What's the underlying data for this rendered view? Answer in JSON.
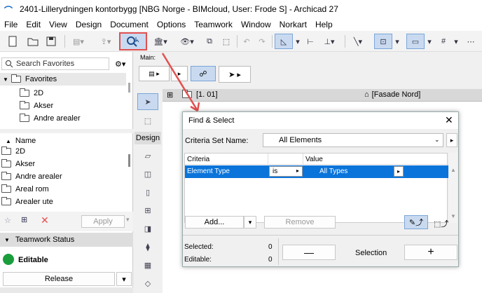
{
  "window": {
    "title": "2401-Lillerydningen kontorbygg [NBG Norge - BIMcloud, User: Frode S] - Archicad 27"
  },
  "menu": [
    "File",
    "Edit",
    "View",
    "Design",
    "Document",
    "Options",
    "Teamwork",
    "Window",
    "Norkart",
    "Help"
  ],
  "toolbar": {
    "main_label": "Main:"
  },
  "navigator": {
    "search_placeholder": "Search Favorites",
    "favorites_header": "Favorites",
    "favorites": [
      "2D",
      "Akser",
      "Andre arealer"
    ],
    "list_header": "Name",
    "list": [
      "2D",
      "Akser",
      "Andre arealer",
      "Areal rom",
      "Arealer ute"
    ],
    "apply_label": "Apply"
  },
  "teamwork": {
    "header": "Teamwork Status",
    "status": "Editable",
    "release_label": "Release"
  },
  "toolbox": {
    "design_label": "Design"
  },
  "tabs": {
    "story": "[1. 01]",
    "view": "[Fasade Nord]"
  },
  "find_select": {
    "title": "Find & Select",
    "criteria_set_label": "Criteria Set Name:",
    "criteria_set_value": "All Elements",
    "col_criteria": "Criteria",
    "col_value": "Value",
    "row": {
      "criteria": "Element Type",
      "operator": "is",
      "value": "All Types"
    },
    "add_label": "Add...",
    "remove_label": "Remove",
    "selected_label": "Selected:",
    "selected_count": "0",
    "editable_label": "Editable:",
    "editable_count": "0",
    "minus_label": "—",
    "selection_label": "Selection",
    "plus_label": "+"
  },
  "colors": {
    "accent": "#0a74da",
    "highlight_red": "#e2504f",
    "editable_green": "#1a9e3c"
  }
}
